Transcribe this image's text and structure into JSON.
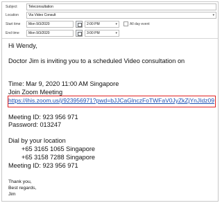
{
  "form": {
    "subject": {
      "label": "Subject",
      "value": "Teleconsultation"
    },
    "location": {
      "label": "Location",
      "value": "Via Video Consult"
    },
    "start": {
      "label": "Start time",
      "date": "Mon 9/3/2020",
      "time": "2:00 PM",
      "all_day_label": "All day event"
    },
    "end": {
      "label": "End time",
      "date": "Mon 9/3/2020",
      "time": "3:00 PM"
    }
  },
  "message": {
    "greeting": "Hi Wendy,",
    "intro": "Doctor Jim is inviting you to a scheduled Video consultation on",
    "time_line": "Time: Mar 9, 2020 11:00 AM Singapore",
    "join_line": "Join Zoom Meeting",
    "link": "https://ihis.zoom.us/j/923956971?pwd=bJJCaGlnczFoTWFaV0JyZkZjYnJIdz09",
    "meeting_id": "Meeting ID: 923 956 971",
    "password": "Password: 013247",
    "dial_heading": "Dial by your location",
    "dial_1": "+65 3165 1065 Singapore",
    "dial_2": "+65 3158 7288 Singapore",
    "meeting_id_2": "Meeting ID: 923 956 971",
    "signoff_1": "Thank you,",
    "signoff_2": "Best regards,",
    "signoff_3": "Jim"
  }
}
